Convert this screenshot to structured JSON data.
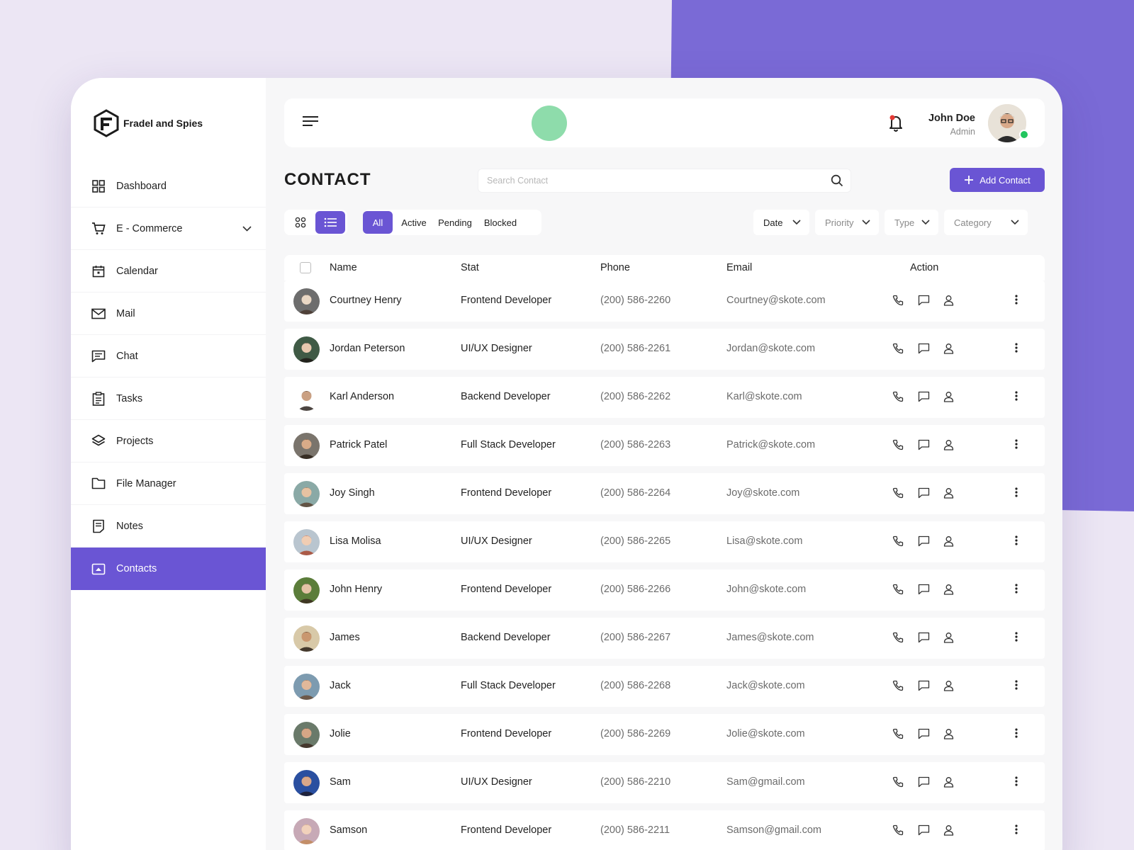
{
  "colors": {
    "accent": "#6a55d4",
    "background": "#ece6f4",
    "online": "#22c55e",
    "highlight_dot": "#8edcab"
  },
  "brand": {
    "name": "Fradel and Spies",
    "logo_icon": "fs-logo-icon"
  },
  "sidebar": {
    "items": [
      {
        "label": "Dashboard",
        "icon": "grid-icon"
      },
      {
        "label": "E - Commerce",
        "icon": "cart-icon",
        "has_submenu": true
      },
      {
        "label": "Calendar",
        "icon": "calendar-icon"
      },
      {
        "label": "Mail",
        "icon": "mail-icon"
      },
      {
        "label": "Chat",
        "icon": "chat-icon"
      },
      {
        "label": "Tasks",
        "icon": "clipboard-icon"
      },
      {
        "label": "Projects",
        "icon": "layers-icon"
      },
      {
        "label": "File Manager",
        "icon": "folder-icon"
      },
      {
        "label": "Notes",
        "icon": "notes-icon"
      },
      {
        "label": "Contacts",
        "icon": "contacts-icon",
        "active": true
      }
    ]
  },
  "header": {
    "user": {
      "name": "John Doe",
      "role": "Admin",
      "online": true
    }
  },
  "page": {
    "title": "CONTACT",
    "search_placeholder": "Search Contact",
    "add_button_label": "Add Contact"
  },
  "status_tabs": [
    {
      "label": "All",
      "active": true
    },
    {
      "label": "Active"
    },
    {
      "label": "Pending"
    },
    {
      "label": "Blocked"
    }
  ],
  "filters": [
    {
      "label": "Date"
    },
    {
      "label": "Priority"
    },
    {
      "label": "Type"
    },
    {
      "label": "Category"
    }
  ],
  "table": {
    "columns": [
      "Name",
      "Stat",
      "Phone",
      "Email",
      "Action"
    ],
    "rows": [
      {
        "name": "Courtney Henry",
        "stat": "Frontend Developer",
        "phone": "(200) 586-2260",
        "email": "Courtney@skote.com"
      },
      {
        "name": "Jordan Peterson",
        "stat": "UI/UX Designer",
        "phone": "(200) 586-2261",
        "email": "Jordan@skote.com"
      },
      {
        "name": "Karl Anderson",
        "stat": "Backend Developer",
        "phone": "(200) 586-2262",
        "email": "Karl@skote.com"
      },
      {
        "name": "Patrick Patel",
        "stat": "Full Stack Developer",
        "phone": "(200) 586-2263",
        "email": "Patrick@skote.com"
      },
      {
        "name": "Joy Singh",
        "stat": "Frontend Developer",
        "phone": "(200) 586-2264",
        "email": "Joy@skote.com"
      },
      {
        "name": "Lisa Molisa",
        "stat": "UI/UX Designer",
        "phone": "(200) 586-2265",
        "email": "Lisa@skote.com"
      },
      {
        "name": "John Henry",
        "stat": "Frontend Developer",
        "phone": "(200) 586-2266",
        "email": "John@skote.com"
      },
      {
        "name": "James",
        "stat": "Backend Developer",
        "phone": "(200) 586-2267",
        "email": "James@skote.com"
      },
      {
        "name": "Jack",
        "stat": "Full Stack Developer",
        "phone": "(200) 586-2268",
        "email": "Jack@skote.com"
      },
      {
        "name": "Jolie",
        "stat": "Frontend Developer",
        "phone": "(200) 586-2269",
        "email": "Jolie@skote.com"
      },
      {
        "name": "Sam",
        "stat": "UI/UX Designer",
        "phone": "(200) 586-2210",
        "email": "Sam@gmail.com"
      },
      {
        "name": "Samson",
        "stat": "Frontend Developer",
        "phone": "(200) 586-2211",
        "email": "Samson@gmail.com"
      }
    ]
  }
}
